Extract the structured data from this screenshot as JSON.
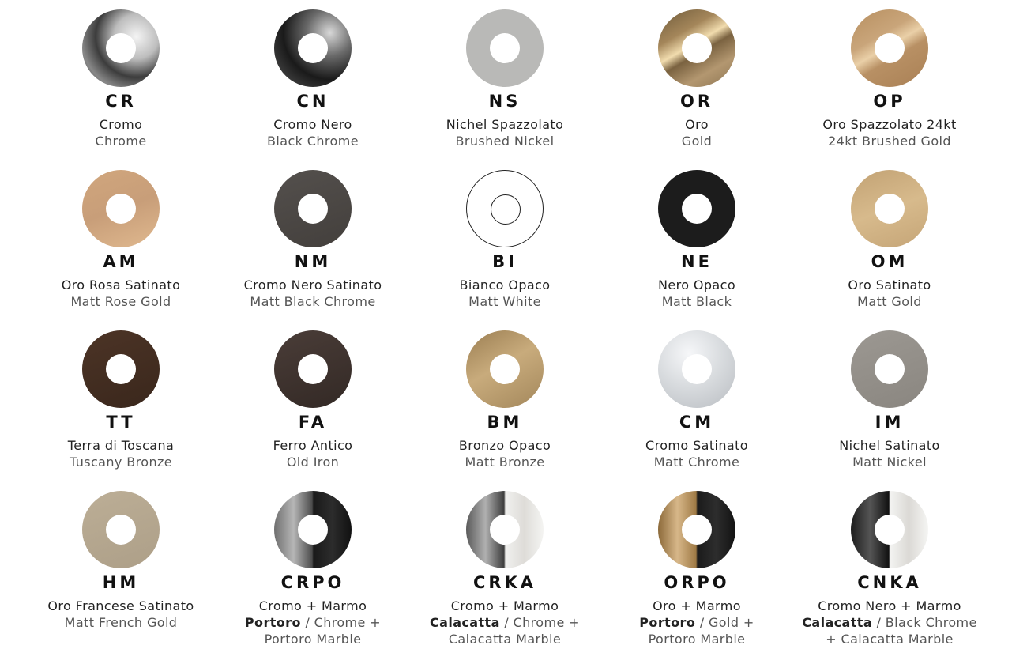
{
  "finishes": [
    {
      "code": "CR",
      "it": "Cromo",
      "en": "Chrome"
    },
    {
      "code": "CN",
      "it": "Cromo Nero",
      "en": "Black Chrome"
    },
    {
      "code": "NS",
      "it": "Nichel Spazzolato",
      "en": "Brushed Nickel"
    },
    {
      "code": "OR",
      "it": "Oro",
      "en": "Gold"
    },
    {
      "code": "OP",
      "it": "Oro Spazzolato 24kt",
      "en": "24kt Brushed Gold"
    },
    {
      "code": "AM",
      "it": "Oro Rosa Satinato",
      "en": "Matt Rose Gold"
    },
    {
      "code": "NM",
      "it": "Cromo Nero Satinato",
      "en": "Matt Black Chrome"
    },
    {
      "code": "BI",
      "it": "Bianco Opaco",
      "en": "Matt White"
    },
    {
      "code": "NE",
      "it": "Nero Opaco",
      "en": "Matt Black"
    },
    {
      "code": "OM",
      "it": "Oro Satinato",
      "en": "Matt Gold"
    },
    {
      "code": "TT",
      "it": "Terra di Toscana",
      "en": "Tuscany Bronze"
    },
    {
      "code": "FA",
      "it": "Ferro Antico",
      "en": "Old Iron"
    },
    {
      "code": "BM",
      "it": "Bronzo Opaco",
      "en": "Matt Bronze"
    },
    {
      "code": "CM",
      "it": "Cromo Satinato",
      "en": "Matt Chrome"
    },
    {
      "code": "IM",
      "it": "Nichel Satinato",
      "en": "Matt Nickel"
    },
    {
      "code": "HM",
      "it": "Oro Francese Satinato",
      "en": "Matt French Gold"
    },
    {
      "code": "CRPO",
      "line1": "Cromo + Marmo",
      "line2_bold": "Portoro",
      "line2_rest": " / Chrome +",
      "line3": "Portoro Marble"
    },
    {
      "code": "CRKA",
      "line1": "Cromo + Marmo",
      "line2_bold": "Calacatta",
      "line2_rest": " / Chrome +",
      "line3": "Calacatta Marble"
    },
    {
      "code": "ORPO",
      "line1": "Oro + Marmo",
      "line2_bold": "Portoro",
      "line2_rest": " / Gold +",
      "line3": "Portoro Marble"
    },
    {
      "code": "CNKA",
      "line1": "Cromo Nero + Marmo",
      "line2_bold": "Calacatta",
      "line2_rest": " / Black Chrome",
      "line3": "+ Calacatta Marble"
    }
  ]
}
